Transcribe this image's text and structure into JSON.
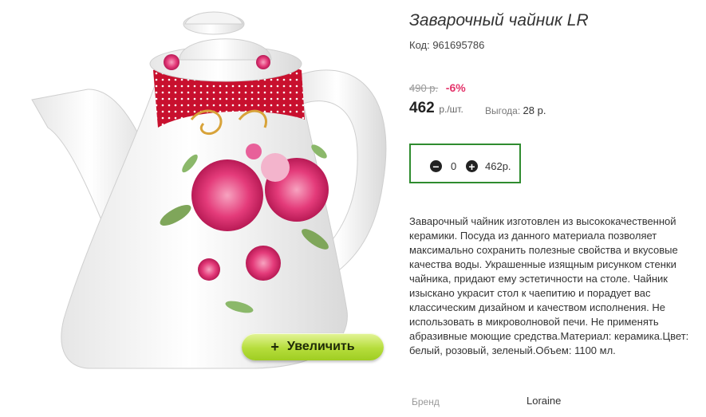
{
  "product": {
    "title": "Заварочный чайник LR",
    "code": "Код: 961695786",
    "image_alt": "teapot-product-photo"
  },
  "price": {
    "old": "490 р.",
    "discount": "-6%",
    "current": "462",
    "unit": "р./шт.",
    "benefit_label": "Выгода:",
    "benefit_value": "28 р."
  },
  "quantity": {
    "value": "0",
    "total": "462р.",
    "minus_icon": "minus-circle-icon",
    "plus_icon": "plus-circle-icon"
  },
  "zoom": {
    "plus": "+",
    "label": "Увеличить"
  },
  "description": "Заварочный чайник изготовлен из высококачественной керамики. Посуда из данного материала позволяет максимально сохранить полезные свойства и вкусовые качества воды. Украшенные изящным рисунком стенки чайника, придают ему эстетичности на столе. Чайник изыскано украсит стол к чаепитию и порадует вас классическим дизайном и качеством исполнения. Не использовать в микроволновой печи. Не применять абразивные моющие средства.Материал: керамика.Цвет: белый, розовый, зеленый.Объем: 1100 мл.",
  "brand": {
    "label": "Бренд",
    "value": "Loraine"
  },
  "colors": {
    "accent_green": "#2f8c2f",
    "discount_pink": "#e4336a",
    "zoom_button": "#b6dd3c",
    "teapot_band_red": "#c8102e"
  }
}
